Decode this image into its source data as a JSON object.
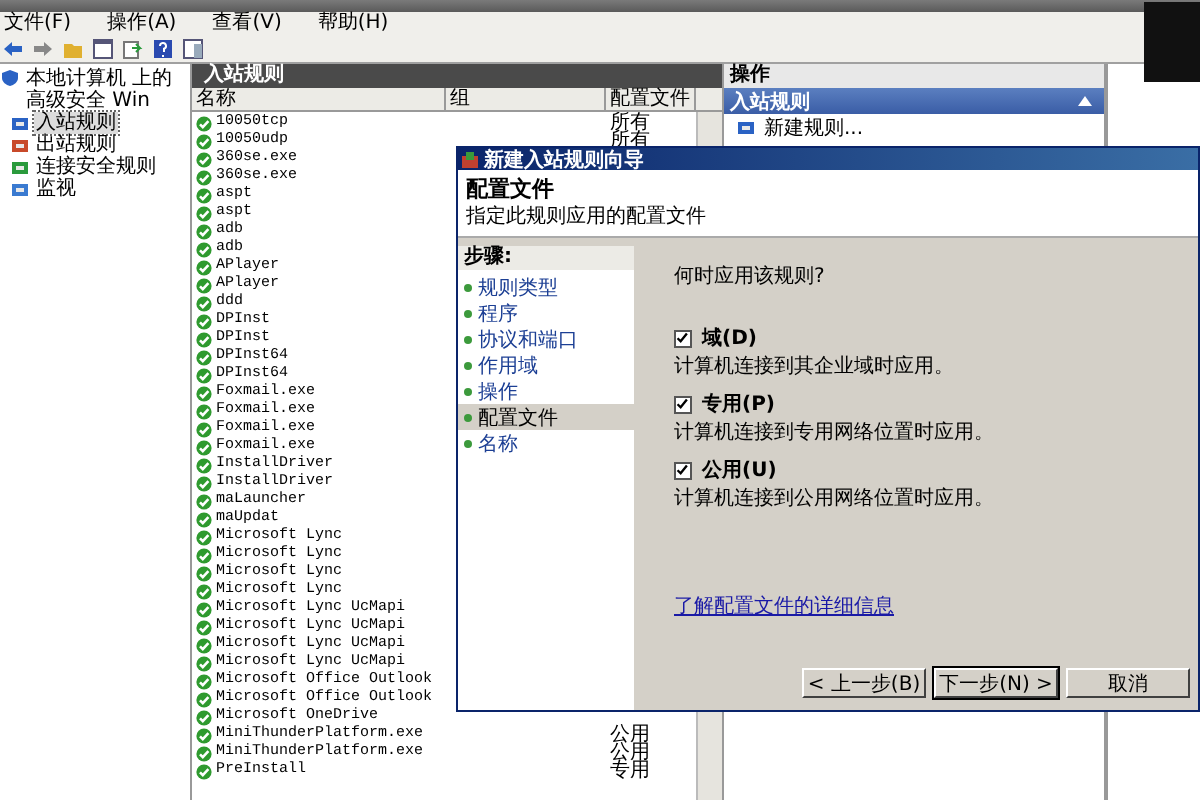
{
  "menu": [
    "文件(F)",
    "操作(A)",
    "查看(V)",
    "帮助(H)"
  ],
  "tree": {
    "items": [
      {
        "label": "本地计算机 上的高级安全 Win",
        "selected": false,
        "children": [
          {
            "label": "入站规则",
            "selected": true
          },
          {
            "label": "出站规则",
            "selected": false
          },
          {
            "label": "连接安全规则",
            "selected": false
          },
          {
            "label": "监视",
            "selected": false
          }
        ]
      }
    ]
  },
  "rules_panel": {
    "title": "入站规则",
    "columns": [
      "名称",
      "组",
      "配置文件"
    ],
    "rows": [
      {
        "name": "10050tcp",
        "profile": "所有"
      },
      {
        "name": "10050udp",
        "profile": "所有"
      },
      {
        "name": "360se.exe"
      },
      {
        "name": "360se.exe"
      },
      {
        "name": "aspt"
      },
      {
        "name": "aspt"
      },
      {
        "name": "adb"
      },
      {
        "name": "adb"
      },
      {
        "name": "APlayer"
      },
      {
        "name": "APlayer"
      },
      {
        "name": "ddd"
      },
      {
        "name": "DPInst"
      },
      {
        "name": "DPInst"
      },
      {
        "name": "DPInst64"
      },
      {
        "name": "DPInst64"
      },
      {
        "name": "Foxmail.exe"
      },
      {
        "name": "Foxmail.exe"
      },
      {
        "name": "Foxmail.exe"
      },
      {
        "name": "Foxmail.exe"
      },
      {
        "name": "InstallDriver"
      },
      {
        "name": "InstallDriver"
      },
      {
        "name": "maLauncher"
      },
      {
        "name": "maUpdat"
      },
      {
        "name": "Microsoft Lync"
      },
      {
        "name": "Microsoft Lync"
      },
      {
        "name": "Microsoft Lync"
      },
      {
        "name": "Microsoft Lync"
      },
      {
        "name": "Microsoft Lync UcMapi"
      },
      {
        "name": "Microsoft Lync UcMapi"
      },
      {
        "name": "Microsoft Lync UcMapi"
      },
      {
        "name": "Microsoft Lync UcMapi"
      },
      {
        "name": "Microsoft Office Outlook"
      },
      {
        "name": "Microsoft Office Outlook"
      },
      {
        "name": "Microsoft OneDrive"
      },
      {
        "name": "MiniThunderPlatform.exe",
        "profile": "公用"
      },
      {
        "name": "MiniThunderPlatform.exe",
        "profile": "公用"
      },
      {
        "name": "PreInstall",
        "profile": "专用"
      }
    ]
  },
  "actions_panel": {
    "title": "操作",
    "section": "入站规则",
    "items": [
      "新建规则..."
    ]
  },
  "dialog": {
    "title": "新建入站规则向导",
    "heading": "配置文件",
    "subtitle": "指定此规则应用的配置文件",
    "steps_title": "步骤:",
    "steps": [
      {
        "label": "规则类型",
        "selected": false
      },
      {
        "label": "程序",
        "selected": false
      },
      {
        "label": "协议和端口",
        "selected": false
      },
      {
        "label": "作用域",
        "selected": false
      },
      {
        "label": "操作",
        "selected": false
      },
      {
        "label": "配置文件",
        "selected": true
      },
      {
        "label": "名称",
        "selected": false
      }
    ],
    "question": "何时应用该规则?",
    "options": [
      {
        "label": "域(D)",
        "description": "计算机连接到其企业域时应用。",
        "checked": true
      },
      {
        "label": "专用(P)",
        "description": "计算机连接到专用网络位置时应用。",
        "checked": true
      },
      {
        "label": "公用(U)",
        "description": "计算机连接到公用网络位置时应用。",
        "checked": true
      }
    ],
    "link": "了解配置文件的详细信息",
    "buttons": [
      {
        "label": "< 上一步(B)",
        "default": false
      },
      {
        "label": "下一步(N) >",
        "default": true
      },
      {
        "label": "取消",
        "default": false
      }
    ]
  }
}
